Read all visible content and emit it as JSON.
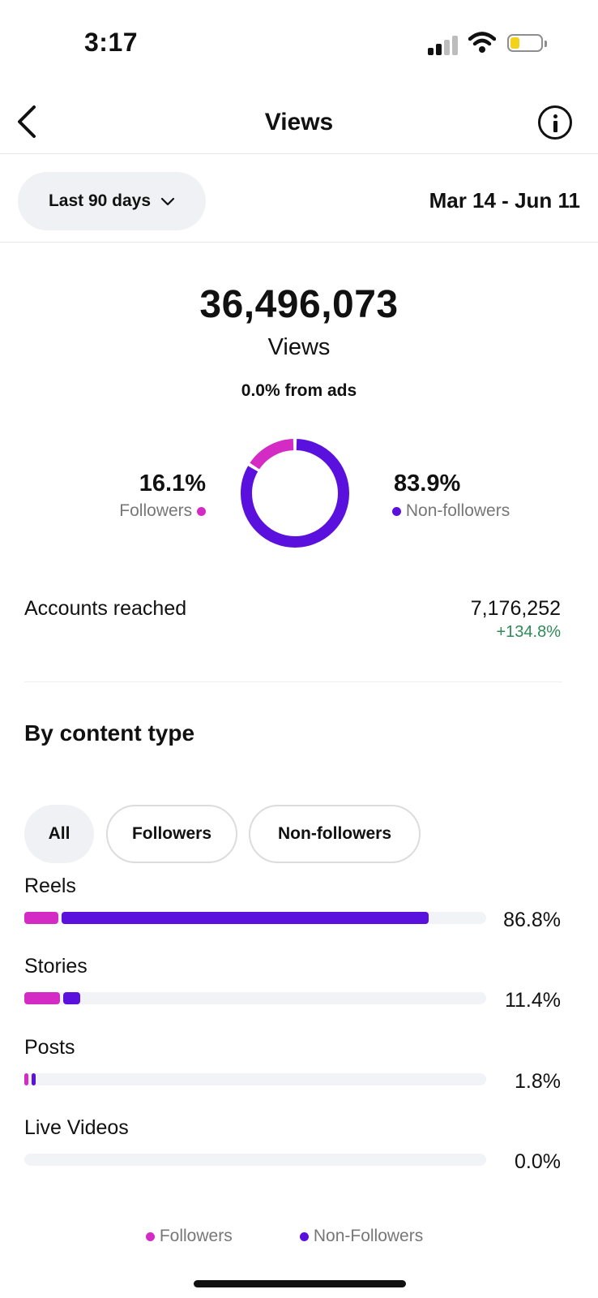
{
  "status_bar": {
    "time": "3:17"
  },
  "header": {
    "title": "Views"
  },
  "filter": {
    "range_label": "Last 90 days",
    "date_range": "Mar 14 - Jun 11"
  },
  "summary": {
    "total": "36,496,073",
    "label": "Views",
    "ads": "0.0% from ads"
  },
  "audience": {
    "followers_pct": "16.1%",
    "followers_label": "Followers",
    "nonfollowers_pct": "83.9%",
    "nonfollowers_label": "Non-followers",
    "followers_fraction": 0.161,
    "nonfollowers_fraction": 0.839
  },
  "accounts": {
    "label": "Accounts reached",
    "value": "7,176,252",
    "change": "+134.8%"
  },
  "content": {
    "title": "By content type",
    "chips": [
      "All",
      "Followers",
      "Non-followers"
    ],
    "rows": [
      {
        "label": "Reels",
        "pct": "86.8%",
        "followers": 0.074,
        "nonfollowers": 0.794
      },
      {
        "label": "Stories",
        "pct": "11.4%",
        "followers": 0.078,
        "nonfollowers": 0.036
      },
      {
        "label": "Posts",
        "pct": "1.8%",
        "followers": 0.009,
        "nonfollowers": 0.009
      },
      {
        "label": "Live Videos",
        "pct": "0.0%",
        "followers": 0,
        "nonfollowers": 0
      }
    ]
  },
  "legend": {
    "followers": "Followers",
    "nonfollowers": "Non-Followers"
  },
  "colors": {
    "followers": "#d42bc4",
    "nonfollowers": "#5a11de",
    "positive": "#2e8b57"
  }
}
